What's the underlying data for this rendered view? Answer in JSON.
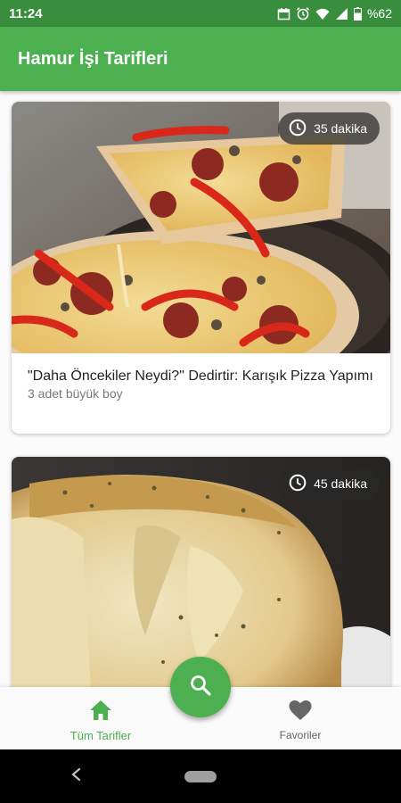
{
  "status_bar": {
    "time": "11:24",
    "battery_percent": "%62",
    "icons": [
      "calendar-icon",
      "alarm-icon",
      "wifi-icon",
      "signal-icon",
      "battery-icon"
    ]
  },
  "app_bar": {
    "title": "Hamur İşi Tarifleri"
  },
  "recipes": [
    {
      "time": "35 dakika",
      "title": "\"Daha Öncekiler Neydi?\" Dedirtir: Karışık Pizza Yapımı",
      "subtitle": "3 adet büyük boy",
      "image": "pizza-photo"
    },
    {
      "time": "45 dakika",
      "title": "",
      "subtitle": "",
      "image": "pastry-bread-photo"
    }
  ],
  "fab": {
    "icon": "search-icon"
  },
  "bottom_nav": {
    "items": [
      {
        "label": "Tüm Tarifler",
        "icon": "home-icon",
        "active": true
      },
      {
        "label": "Favoriler",
        "icon": "heart-icon",
        "active": false
      }
    ]
  },
  "colors": {
    "primary": "#4caf50",
    "primary_dark": "#388e3c",
    "active_nav": "#4caf50",
    "inactive_nav": "#666666"
  }
}
